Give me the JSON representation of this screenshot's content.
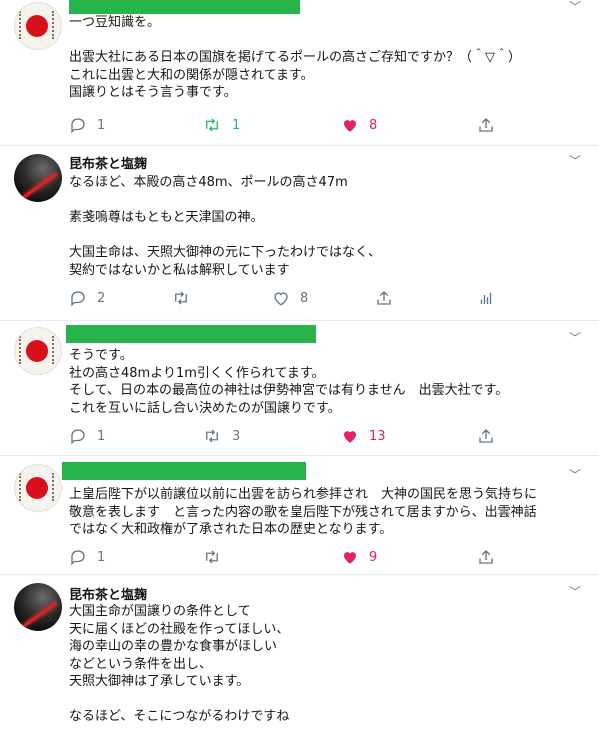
{
  "tweets": [
    {
      "avatar": "rising-sun-flag",
      "author": "",
      "text": "一つ豆知識を。\n\n出雲大社にある日本の国旗を掲げてるポールの高さご存知ですか？（＾▽＾）\nこれに出雲と大和の関係が隠されてます。\n国譲りとはそう言う事です。",
      "replies": "1",
      "retweets": "1",
      "likes": "8",
      "retweeted": true,
      "liked": true
    },
    {
      "avatar": "lightsaber",
      "author": "昆布茶と塩麹",
      "text": "なるほど、本殿の高さ48m、ポールの高さ47m\n\n素戔嗚尊はもともと天津国の神。\n\n大国主命は、天照大御神の元に下ったわけではなく、\n契約ではないかと私は解釈しています",
      "replies": "2",
      "retweets": "",
      "likes": "8",
      "retweeted": false,
      "liked": false
    },
    {
      "avatar": "rising-sun-flag",
      "author": "",
      "text": "そうです。\n社の高さ48mより1m引くく作られてます。\nそして、日の本の最高位の神社は伊勢神宮では有りません　出雲大社です。\nこれを互いに話し合い決めたのが国譲りです。",
      "replies": "1",
      "retweets": "3",
      "likes": "13",
      "retweeted": false,
      "liked": true
    },
    {
      "avatar": "rising-sun-flag",
      "author": "",
      "text": "上皇后陛下が以前譲位以前に出雲を訪られ参拝され　大神の国民を思う気持ちに\n敬意を表します　と言った内容の歌を皇后陛下が残されて居ますから、出雲神話\nではなく大和政権が了承された日本の歴史となります。",
      "replies": "1",
      "retweets": "",
      "likes": "9",
      "retweeted": false,
      "liked": true
    },
    {
      "avatar": "lightsaber",
      "author": "昆布茶と塩麹",
      "text": "大国主命が国譲りの条件として\n天に届くほどの社殿を作ってほしい、\n海の幸山の幸の豊かな食事がほしい\nなどという条件を出し、\n天照大御神は了承しています。\n\nなるほど、そこにつながるわけですね"
    }
  ],
  "colors": {
    "redaction": "#28b44b",
    "like": "#e0245e",
    "retweet": "#17bf63",
    "muted": "#657786"
  }
}
